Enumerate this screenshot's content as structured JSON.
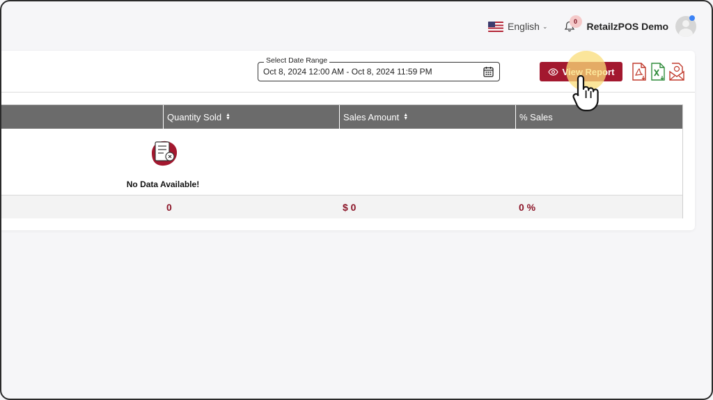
{
  "header": {
    "language": "English",
    "notification_count": "0",
    "user_name": "RetailzPOS Demo"
  },
  "filters": {
    "date_range_label": "Select Date Range",
    "date_range_value": "Oct 8, 2024 12:00 AM - Oct 8, 2024 11:59 PM"
  },
  "actions": {
    "view_report_label": "View Report"
  },
  "table": {
    "columns": [
      {
        "label": "Quantity Sold",
        "sortable": true
      },
      {
        "label": "Sales Amount",
        "sortable": true
      },
      {
        "label": "% Sales",
        "sortable": false
      }
    ],
    "empty_text": "No Data Available!",
    "totals": {
      "quantity": "0",
      "amount": "$ 0",
      "percent": "0 %"
    }
  },
  "colors": {
    "brand": "#a3182f",
    "header_bg": "#6b6b6b",
    "total_text": "#8b1427"
  },
  "icons": [
    "flag-us-icon",
    "chevron-down-icon",
    "bell-icon",
    "avatar",
    "calendar-icon",
    "eye-icon",
    "pdf-export-icon",
    "excel-export-icon",
    "email-export-icon",
    "no-data-icon",
    "hand-pointer-cursor"
  ]
}
